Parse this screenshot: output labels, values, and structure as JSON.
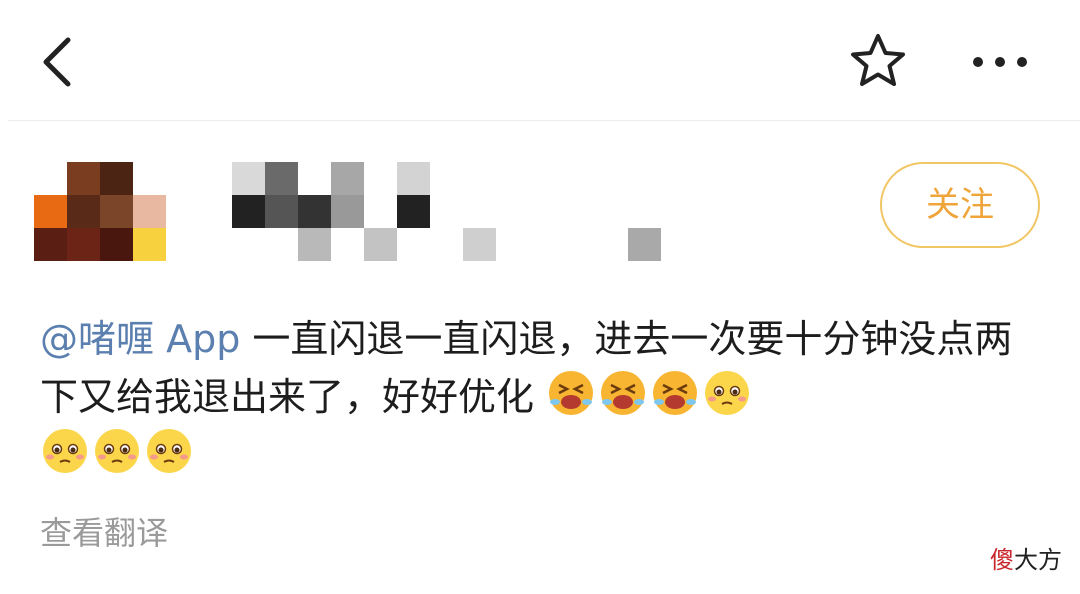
{
  "header": {
    "back_icon": "chevron-left-icon",
    "favorite_icon": "star-outline-icon",
    "more_icon": "more-dots-icon"
  },
  "author": {
    "avatar_note": "pixelated",
    "name_note": "pixelated",
    "follow_label": "关注",
    "follow_color": "#f0a53b"
  },
  "post": {
    "mention": "@啫喱 App",
    "text": " 一直闪退一直闪退，进去一次要十分钟没点两下又给我退出来了，好好优化",
    "emojis": [
      "crying-face",
      "crying-face",
      "crying-face",
      "pleading-face",
      "pleading-face",
      "pleading-face",
      "pleading-face"
    ],
    "mention_color": "#5b7fae"
  },
  "footer": {
    "translate_label": "查看翻译"
  },
  "watermark": {
    "first_char": "傻",
    "rest": "大方"
  }
}
